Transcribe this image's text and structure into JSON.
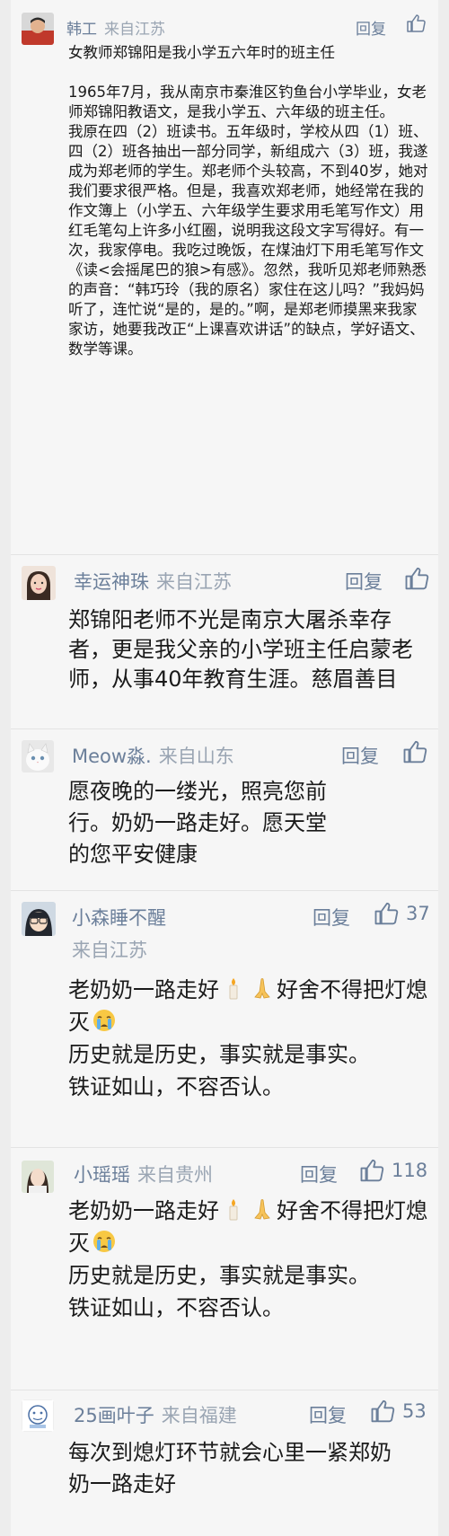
{
  "comments": [
    {
      "name": "韩工",
      "location": "来自江苏",
      "reply": "回复",
      "paragraphs": [
        "女教师郑锦阳是我小学五六年时的班主任",
        "",
        "1965年7月，我从南京市秦淮区钓鱼台小学毕业，女老师郑锦阳教语文，是我小学五、六年级的班主任。",
        "我原在四（2）班读书。五年级时，学校从四（1）班、四（2）班各抽出一部分同学，新组成六（3）班，我遂成为郑老师的学生。郑老师个头较高，不到40岁，她对我们要求很严格。但是，我喜欢郑老师，她经常在我的作文簿上（小学五、六年级学生要求用毛笔写作文）用红毛笔勾上许多小红圈，说明我这段文字写得好。有一次，我家停电。我吃过晚饭，在煤油灯下用毛笔写作文《读<会摇尾巴的狼>有感》。忽然，我听见郑老师熟悉的声音：“韩巧玲（我的原名）家住在这儿吗？”我妈妈听了，连忙说“是的，是的。”啊，是郑老师摸黑来我家家访，她要我改正“上课喜欢讲话”的缺点，学好语文、数学等课。"
      ]
    },
    {
      "name": "幸运神珠",
      "location": "来自江苏",
      "reply": "回复",
      "text": "郑锦阳老师不光是南京大屠杀幸存者，更是我父亲的小学班主任启蒙老师，从事40年教育生涯。慈眉善目"
    },
    {
      "name": "Meow淼.",
      "location": "来自山东",
      "reply": "回复",
      "text": "愿夜晚的一缕光，照亮您前行。奶奶一路走好。愿天堂的您平安健康"
    },
    {
      "name": "小森睡不醒",
      "location": "来自江苏",
      "reply": "回复",
      "likes": "37",
      "line1_a": "老奶奶一路走好",
      "line1_b": "好舍不得把灯熄灭",
      "rest": [
        "历史就是历史，事实就是事实。",
        "铁证如山，不容否认。"
      ]
    },
    {
      "name": "小瑶瑶",
      "location": "来自贵州",
      "reply": "回复",
      "likes": "118",
      "line1_a": "老奶奶一路走好",
      "line1_b": "好舍不得把灯熄灭",
      "rest": [
        "历史就是历史，事实就是事实。",
        "铁证如山，不容否认。"
      ]
    },
    {
      "name": "25画叶子",
      "location": "来自福建",
      "reply": "回复",
      "likes": "53",
      "text": "每次到熄灯环节就会心里一紧郑奶奶一路走好"
    }
  ],
  "icons": {
    "like": "thumbs-up-icon",
    "candle": "candle-emoji",
    "pray": "folded-hands-emoji",
    "cry": "crying-face-emoji"
  },
  "colors": {
    "name": "#6b7f9a",
    "text": "#1a1a1a",
    "background": "#f6f6f6"
  }
}
